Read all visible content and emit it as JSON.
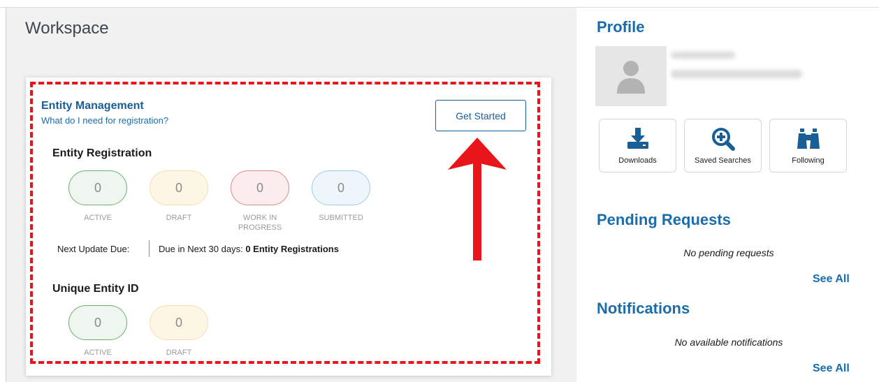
{
  "workspace": {
    "title": "Workspace",
    "entity_management": {
      "title": "Entity Management",
      "link": "What do I need for registration?",
      "get_started_label": "Get Started",
      "entity_registration": {
        "title": "Entity Registration",
        "counts": [
          {
            "value": "0",
            "label": "ACTIVE",
            "status": "active"
          },
          {
            "value": "0",
            "label": "DRAFT",
            "status": "draft"
          },
          {
            "value": "0",
            "label": "WORK IN PROGRESS",
            "status": "wip"
          },
          {
            "value": "0",
            "label": "SUBMITTED",
            "status": "submitted"
          }
        ],
        "next_update_label": "Next Update Due:",
        "due_prefix": "Due in Next 30 days:",
        "due_value": "0 Entity Registrations"
      },
      "unique_entity_id": {
        "title": "Unique Entity ID",
        "counts": [
          {
            "value": "0",
            "label": "ACTIVE",
            "status": "active"
          },
          {
            "value": "0",
            "label": "DRAFT",
            "status": "draft"
          }
        ]
      }
    }
  },
  "profile": {
    "title": "Profile",
    "shortcuts": [
      {
        "label": "Downloads",
        "icon": "download-icon"
      },
      {
        "label": "Saved Searches",
        "icon": "zoom-in-icon"
      },
      {
        "label": "Following",
        "icon": "binoculars-icon"
      }
    ]
  },
  "pending_requests": {
    "title": "Pending Requests",
    "empty_message": "No pending requests",
    "see_all_label": "See All"
  },
  "notifications": {
    "title": "Notifications",
    "empty_message": "No available notifications",
    "see_all_label": "See All"
  },
  "colors": {
    "brand_blue": "#1a5e96",
    "link_blue": "#1a6dab",
    "annotation_red": "#e8161b",
    "active_border": "#6fae73",
    "draft_border": "#f4dfae",
    "wip_border": "#d98b8b",
    "submitted_border": "#9fcde8"
  }
}
